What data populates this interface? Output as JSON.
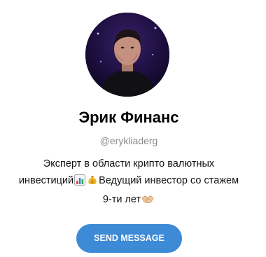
{
  "profile": {
    "name": "Эрик Финанс",
    "username": "@erykliaderg",
    "bio": {
      "line1": "Эксперт в области крипто валютных",
      "line2_a": "инвестиций",
      "line2_b": "Ведущий инвестор со стажем",
      "line3": "9-ти лет"
    },
    "emoji_icons": [
      "bar-chart-icon",
      "money-bag-icon",
      "handshake-icon"
    ],
    "send_button_label": "SEND MESSAGE"
  },
  "colors": {
    "button": "#3d8ad6",
    "username": "#8a8a8a",
    "avatar_bg": "#1a0a3a"
  }
}
